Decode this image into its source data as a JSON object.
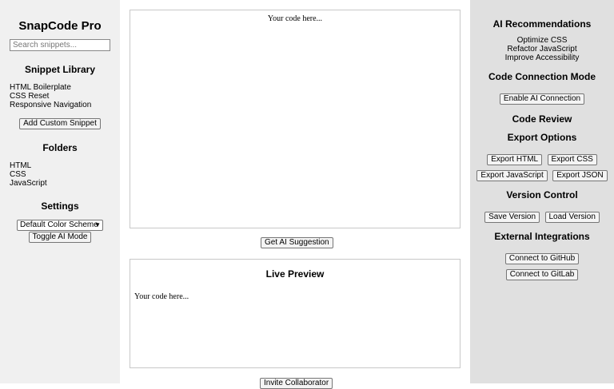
{
  "app": {
    "title": "SnapCode Pro"
  },
  "search": {
    "placeholder": "Search snippets..."
  },
  "snippet_library": {
    "heading": "Snippet Library",
    "items": [
      "HTML Boilerplate",
      "CSS Reset",
      "Responsive Navigation"
    ],
    "add_button": "Add Custom Snippet"
  },
  "folders": {
    "heading": "Folders",
    "items": [
      "HTML",
      "CSS",
      "JavaScript"
    ]
  },
  "settings": {
    "heading": "Settings",
    "color_scheme_selected": "Default Color Scheme",
    "toggle_ai_button": "Toggle AI Mode"
  },
  "editor": {
    "placeholder": "Your code here..."
  },
  "get_ai_button": "Get AI Suggestion",
  "preview": {
    "heading": "Live Preview",
    "content": "Your code here..."
  },
  "invite_button": "Invite Collaborator",
  "ai_recommendations": {
    "heading": "AI Recommendations",
    "items": [
      "Optimize CSS",
      "Refactor JavaScript",
      "Improve Accessibility"
    ]
  },
  "connection_mode": {
    "heading": "Code Connection Mode",
    "button": "Enable AI Connection"
  },
  "code_review": {
    "heading": "Code Review"
  },
  "export_options": {
    "heading": "Export Options",
    "buttons": [
      "Export HTML",
      "Export CSS",
      "Export JavaScript",
      "Export JSON"
    ]
  },
  "version_control": {
    "heading": "Version Control",
    "buttons": [
      "Save Version",
      "Load Version"
    ]
  },
  "integrations": {
    "heading": "External Integrations",
    "buttons": [
      "Connect to GitHub",
      "Connect to GitLab"
    ]
  }
}
